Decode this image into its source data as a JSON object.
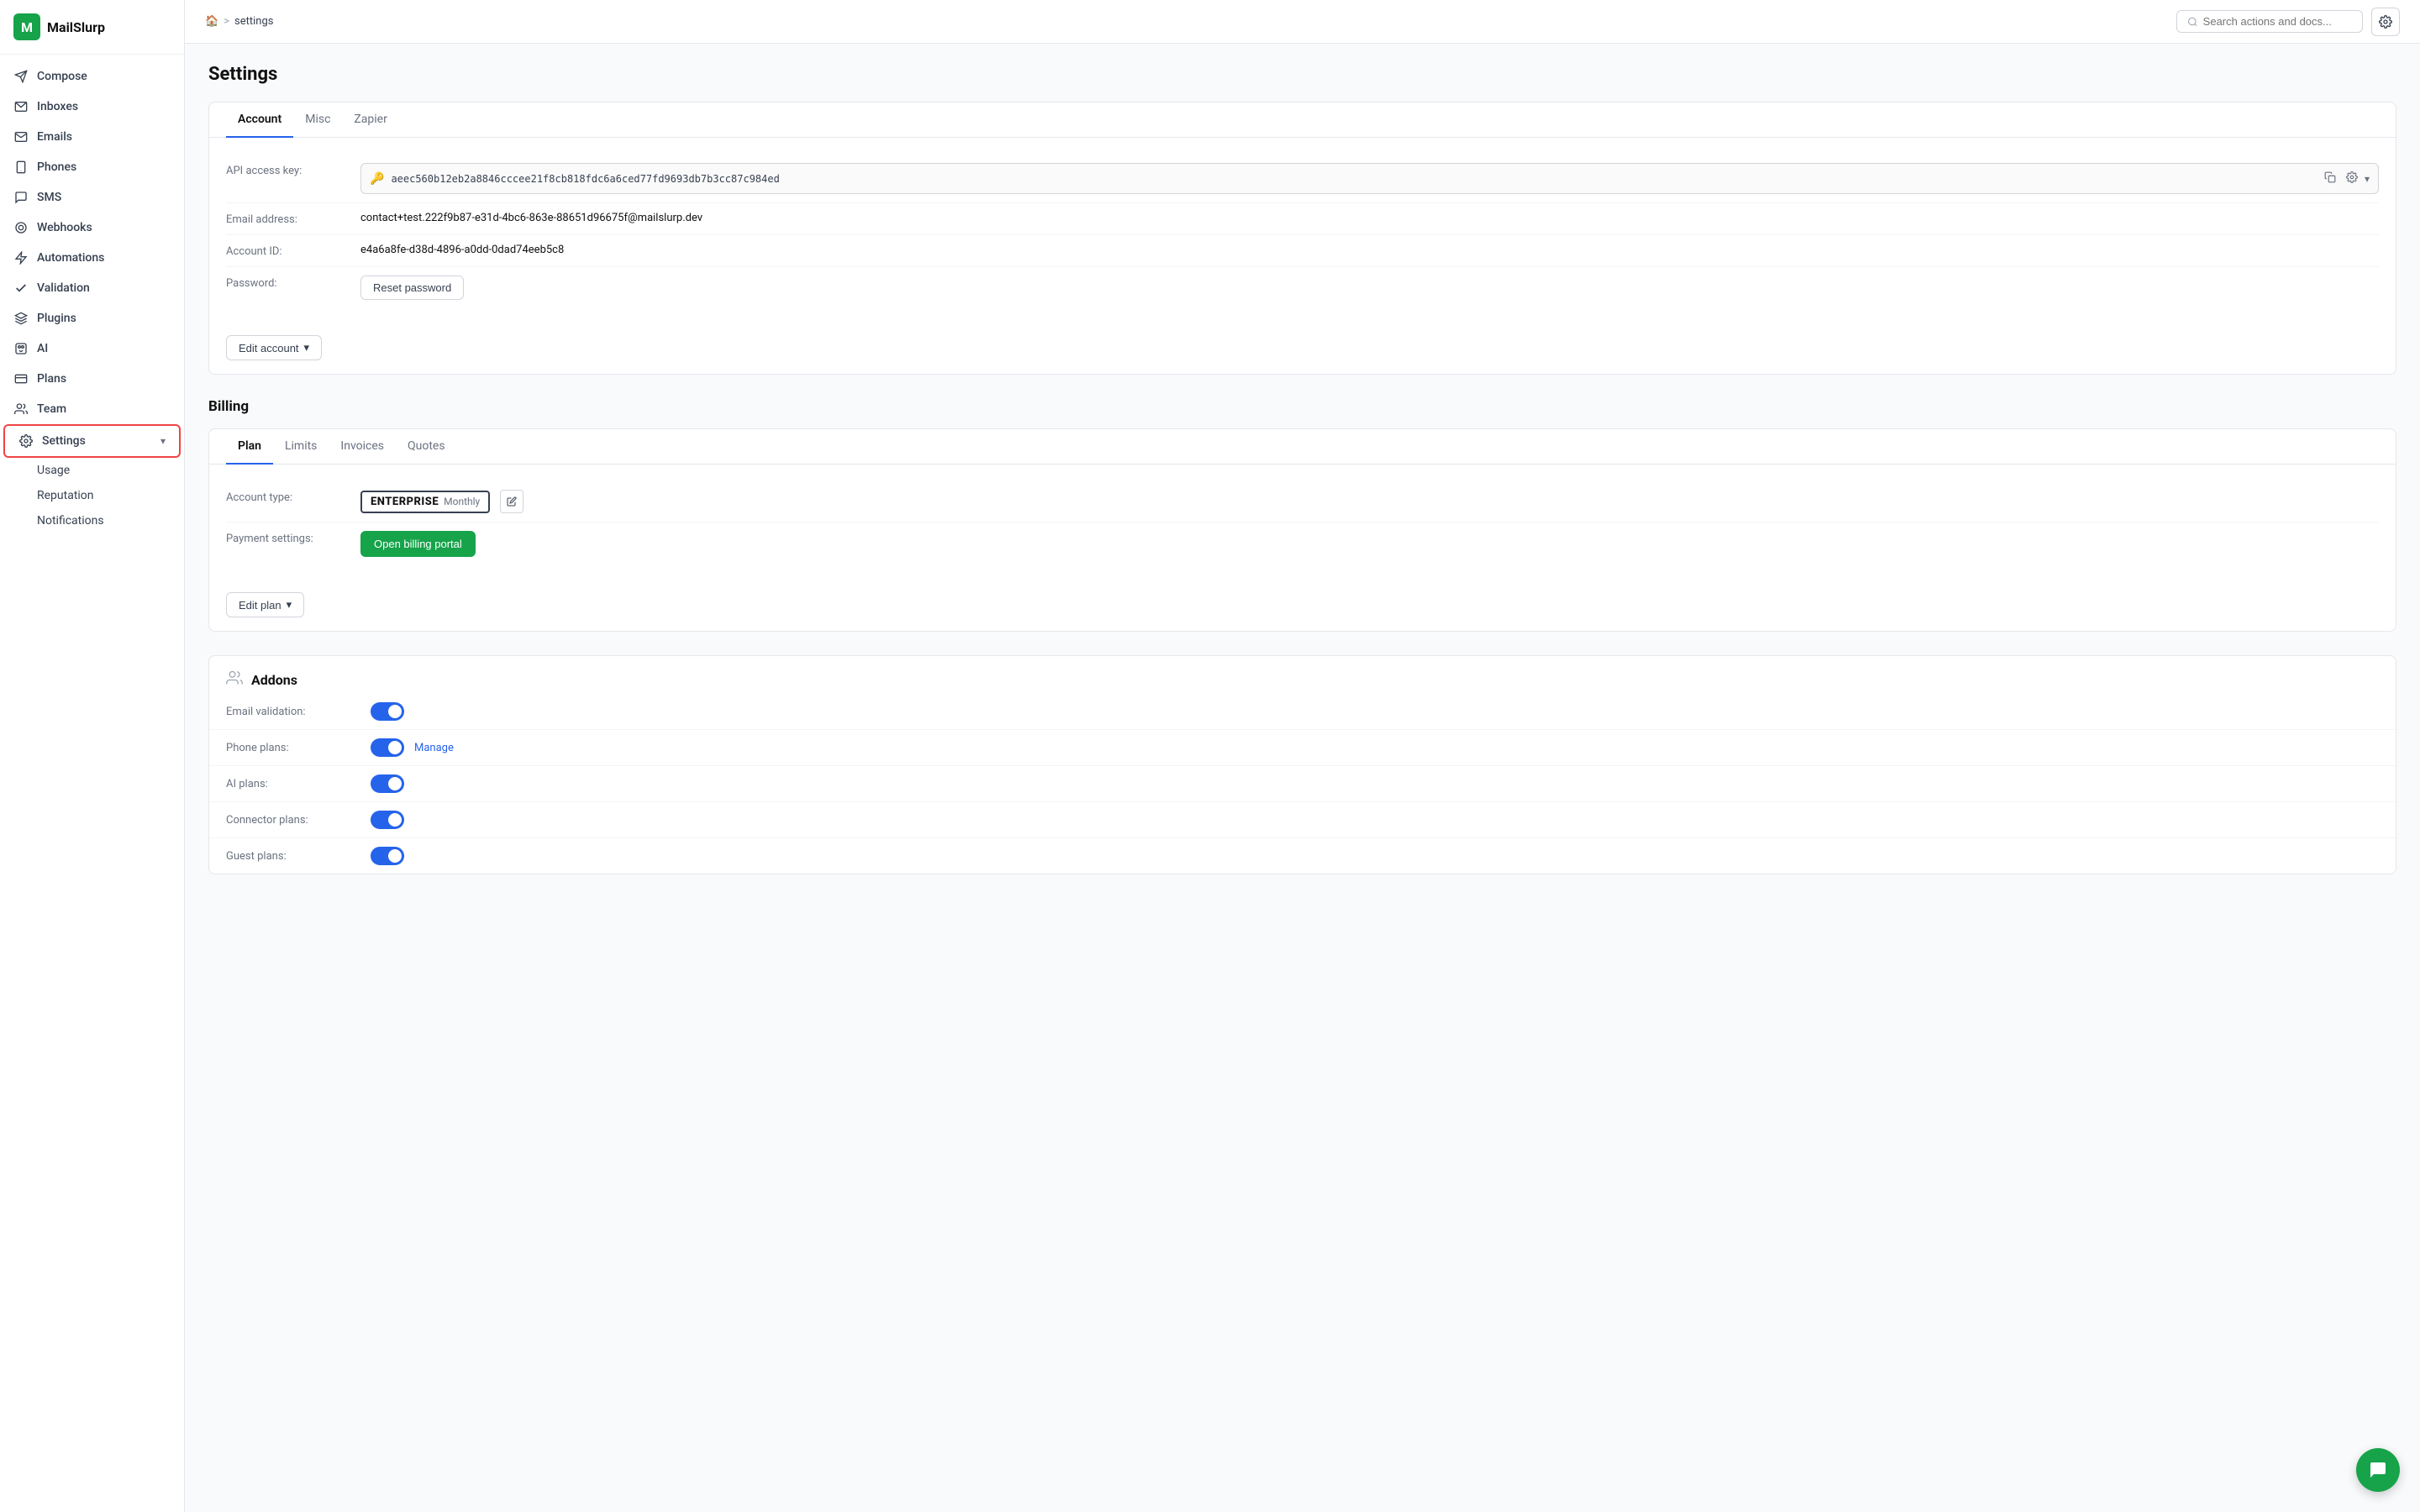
{
  "app": {
    "name": "MailSlurp",
    "logo_letter": "M"
  },
  "sidebar": {
    "items": [
      {
        "id": "compose",
        "label": "Compose",
        "icon": "compose"
      },
      {
        "id": "inboxes",
        "label": "Inboxes",
        "icon": "inbox"
      },
      {
        "id": "emails",
        "label": "Emails",
        "icon": "email"
      },
      {
        "id": "phones",
        "label": "Phones",
        "icon": "phone"
      },
      {
        "id": "sms",
        "label": "SMS",
        "icon": "sms"
      },
      {
        "id": "webhooks",
        "label": "Webhooks",
        "icon": "webhook"
      },
      {
        "id": "automations",
        "label": "Automations",
        "icon": "automation"
      },
      {
        "id": "validation",
        "label": "Validation",
        "icon": "check"
      },
      {
        "id": "plugins",
        "label": "Plugins",
        "icon": "plugin"
      },
      {
        "id": "ai",
        "label": "AI",
        "icon": "ai"
      },
      {
        "id": "plans",
        "label": "Plans",
        "icon": "plans"
      },
      {
        "id": "team",
        "label": "Team",
        "icon": "team"
      },
      {
        "id": "settings",
        "label": "Settings",
        "icon": "gear",
        "active": true,
        "expanded": true
      }
    ],
    "sub_items": [
      {
        "id": "usage",
        "label": "Usage"
      },
      {
        "id": "reputation",
        "label": "Reputation"
      },
      {
        "id": "notifications",
        "label": "Notifications"
      }
    ]
  },
  "breadcrumb": {
    "home": "🏠",
    "separator": ">",
    "current": "settings"
  },
  "search": {
    "placeholder": "Search actions and docs..."
  },
  "page": {
    "title": "Settings"
  },
  "account_tabs": [
    {
      "id": "account",
      "label": "Account",
      "active": true
    },
    {
      "id": "misc",
      "label": "Misc"
    },
    {
      "id": "zapier",
      "label": "Zapier"
    }
  ],
  "account_fields": {
    "api_key_label": "API access key:",
    "api_key_value": "aeec560b12eb2a8846cccee21f8cb818fdc6a6ced77fd9693db7b3cc87c984ed",
    "email_label": "Email address:",
    "email_value": "contact+test.222f9b87-e31d-4bc6-863e-88651d96675f@mailslurp.dev",
    "account_id_label": "Account ID:",
    "account_id_value": "e4a6a8fe-d38d-4896-a0dd-0dad74eeb5c8",
    "password_label": "Password:",
    "reset_password_btn": "Reset password",
    "edit_account_btn": "Edit account"
  },
  "billing": {
    "title": "Billing",
    "tabs": [
      {
        "id": "plan",
        "label": "Plan",
        "active": true
      },
      {
        "id": "limits",
        "label": "Limits"
      },
      {
        "id": "invoices",
        "label": "Invoices"
      },
      {
        "id": "quotes",
        "label": "Quotes"
      }
    ],
    "account_type_label": "Account type:",
    "enterprise_label": "ENTERPRISE",
    "monthly_label": "Monthly",
    "payment_label": "Payment settings:",
    "open_billing_btn": "Open billing portal",
    "edit_plan_btn": "Edit plan"
  },
  "addons": {
    "title": "Addons",
    "items": [
      {
        "id": "email_validation",
        "label": "Email validation:",
        "enabled": true,
        "manage": false
      },
      {
        "id": "phone_plans",
        "label": "Phone plans:",
        "enabled": true,
        "manage": true,
        "manage_label": "Manage"
      },
      {
        "id": "ai_plans",
        "label": "AI plans:",
        "enabled": true,
        "manage": false
      },
      {
        "id": "connector_plans",
        "label": "Connector plans:",
        "enabled": true,
        "manage": false
      },
      {
        "id": "guest_plans",
        "label": "Guest plans:",
        "enabled": true,
        "manage": false
      }
    ]
  },
  "colors": {
    "accent": "#2563eb",
    "green": "#16a34a",
    "red_border": "#ef4444"
  }
}
